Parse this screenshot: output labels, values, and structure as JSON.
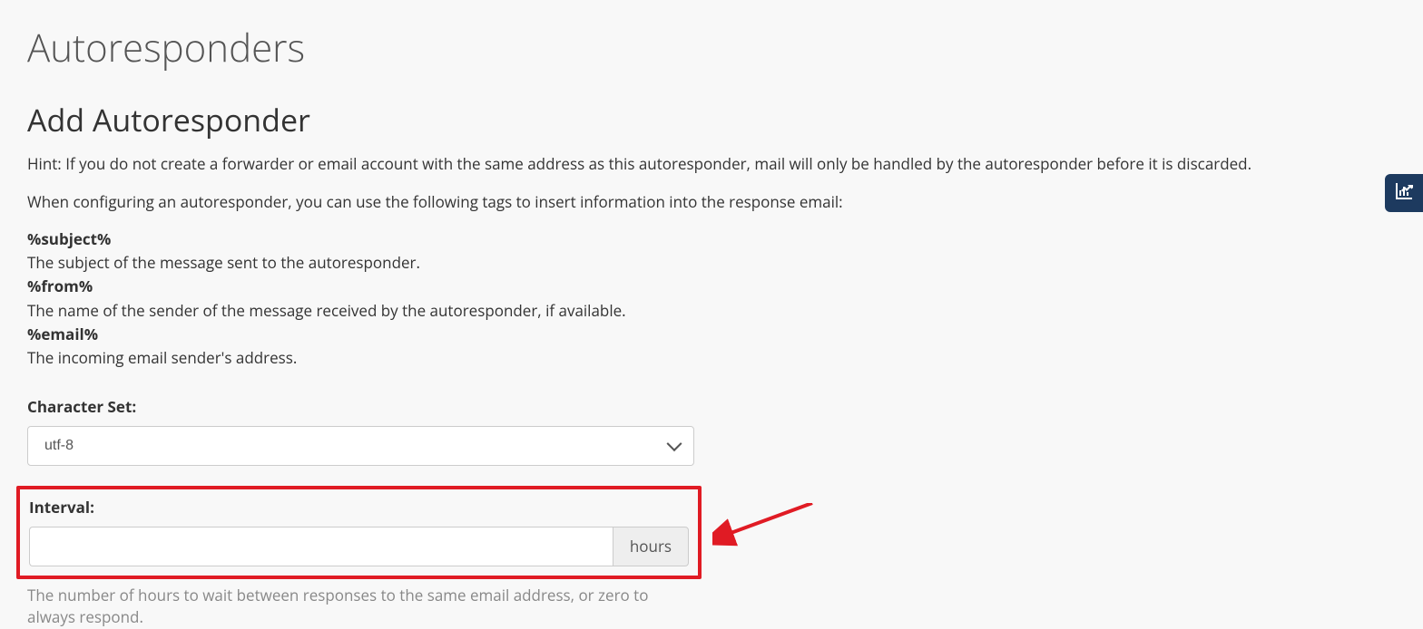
{
  "page": {
    "title": "Autoresponders",
    "section_title": "Add Autoresponder",
    "hint": "Hint: If you do not create a forwarder or email account with the same address as this autoresponder, mail will only be handled by the autoresponder before it is discarded.",
    "intro": "When configuring an autoresponder, you can use the following tags to insert information into the response email:"
  },
  "tags": [
    {
      "name": "%subject%",
      "desc": "The subject of the message sent to the autoresponder."
    },
    {
      "name": "%from%",
      "desc": "The name of the sender of the message received by the autoresponder, if available."
    },
    {
      "name": "%email%",
      "desc": "The incoming email sender's address."
    }
  ],
  "form": {
    "charset_label": "Character Set:",
    "charset_value": "utf-8",
    "interval_label": "Interval:",
    "interval_value": "",
    "interval_unit": "hours",
    "interval_help": "The number of hours to wait between responses to the same email address, or zero to always respond."
  }
}
